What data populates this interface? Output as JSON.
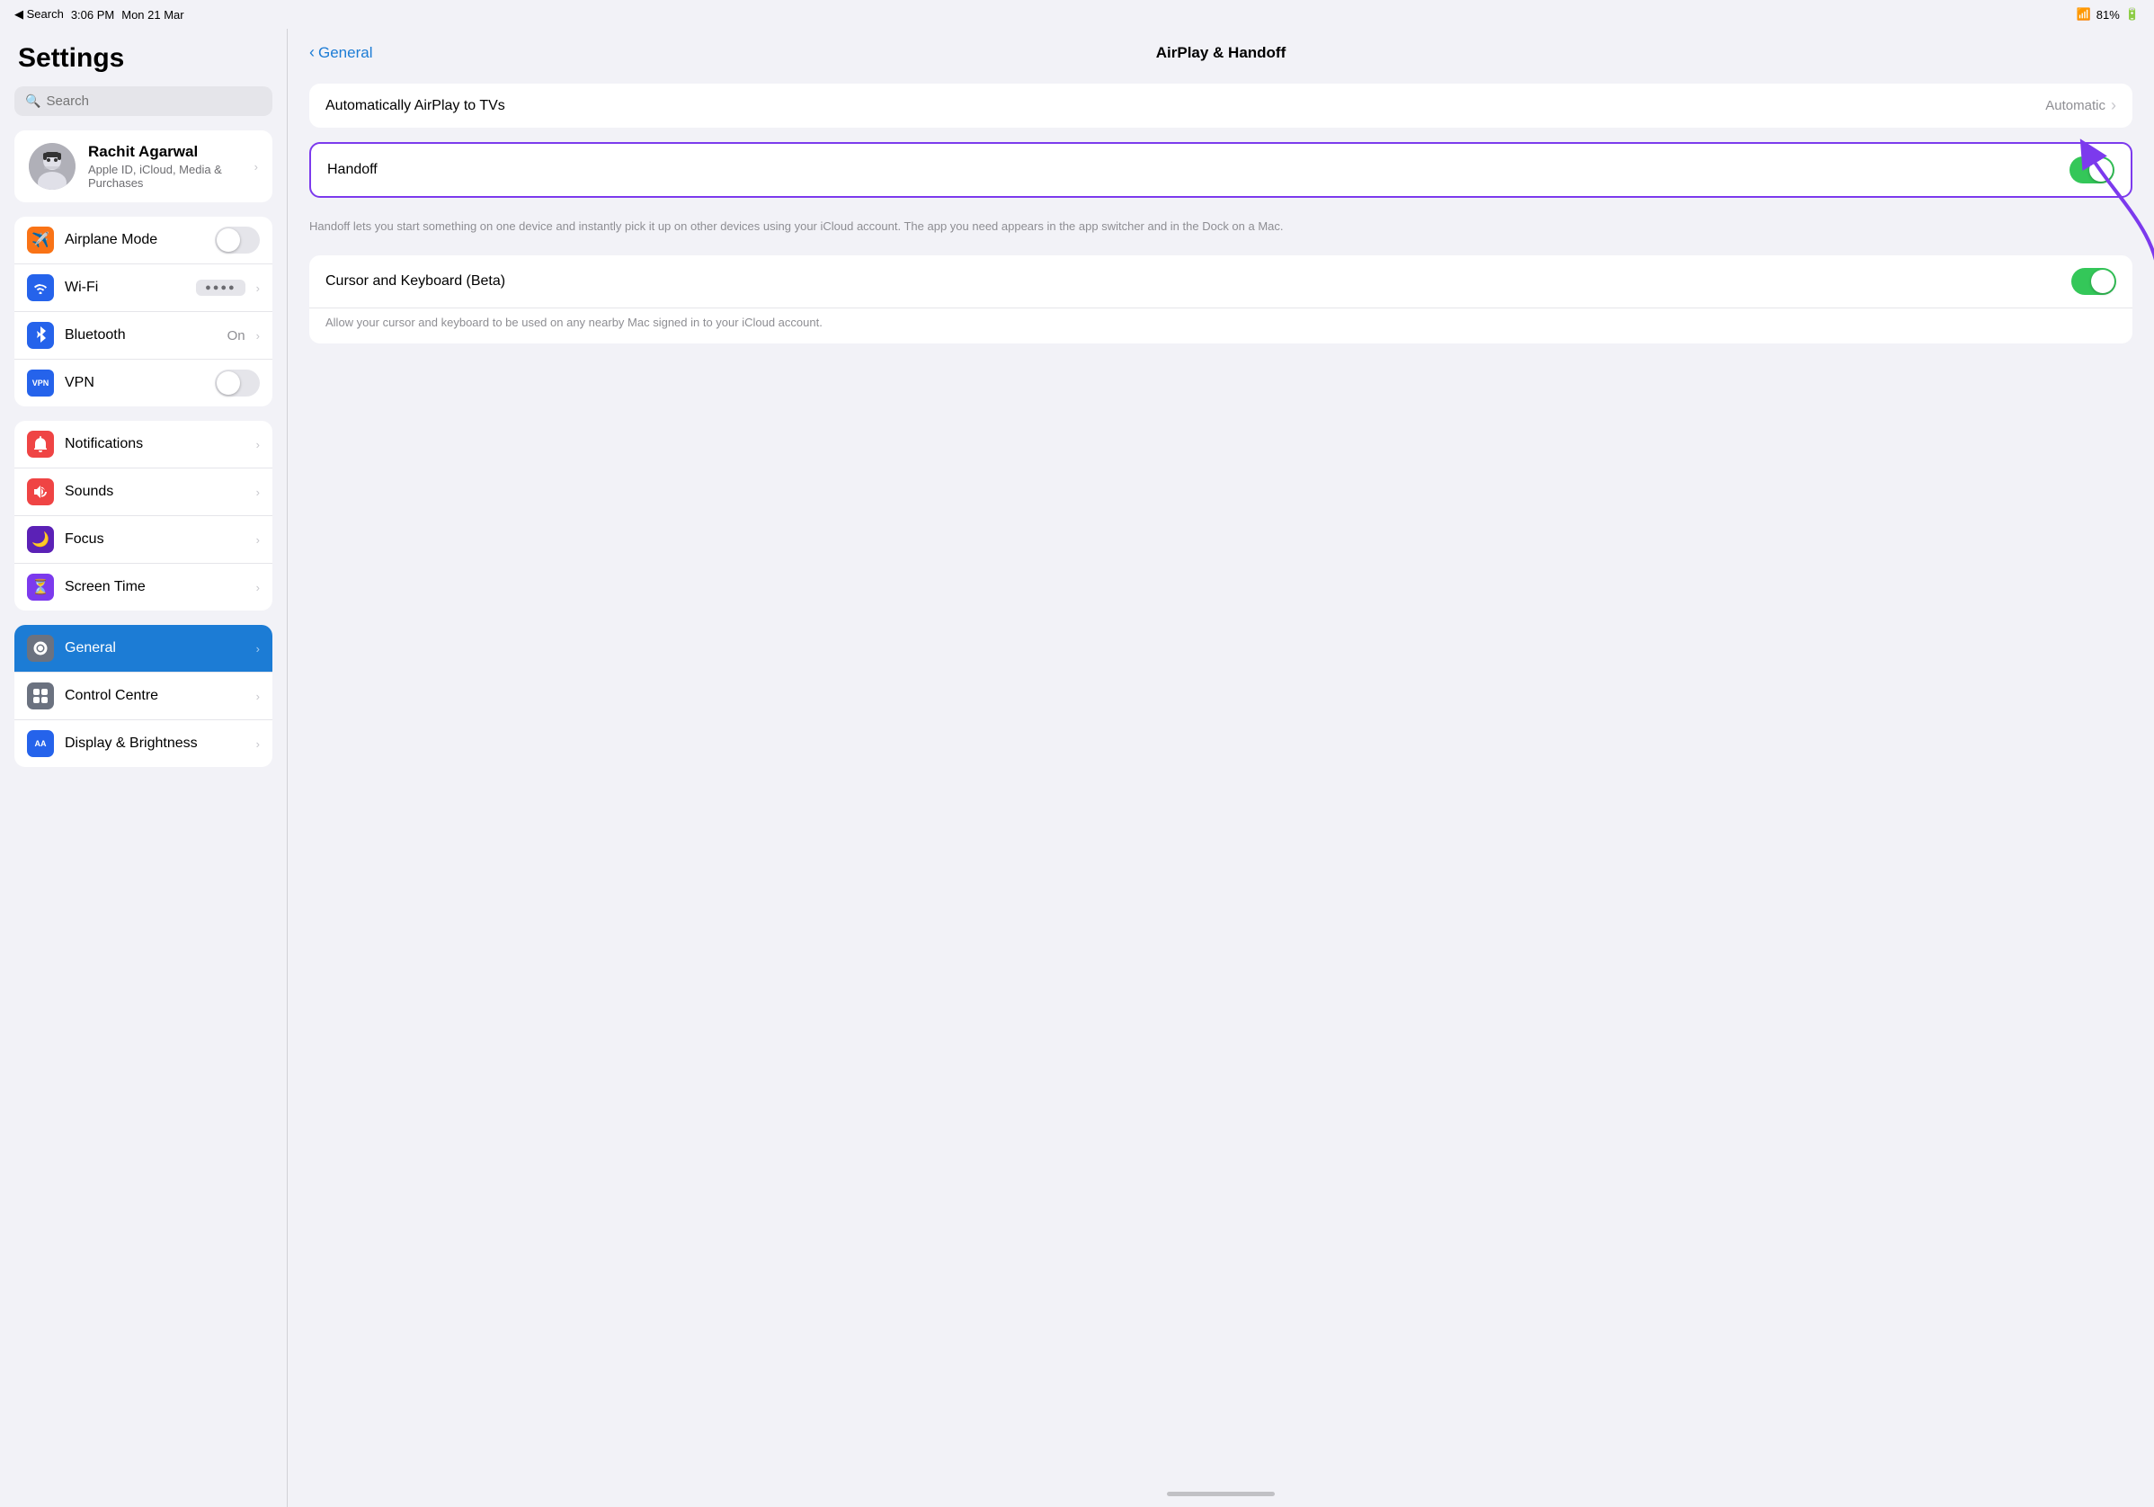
{
  "statusBar": {
    "back": "◀ Search",
    "time": "3:06 PM",
    "date": "Mon 21 Mar",
    "battery": "81%"
  },
  "sidebar": {
    "title": "Settings",
    "search": {
      "placeholder": "Search"
    },
    "profile": {
      "name": "Rachit Agarwal",
      "subtitle": "Apple ID, iCloud, Media & Purchases",
      "avatar_emoji": "🧑‍💻"
    },
    "group1": [
      {
        "id": "airplane",
        "label": "Airplane Mode",
        "control": "toggle-off",
        "icon_bg": "#f97316",
        "icon": "✈️"
      },
      {
        "id": "wifi",
        "label": "Wi-Fi",
        "control": "wifi-value",
        "value": "●●●●●●",
        "icon_bg": "#2563eb",
        "icon": "📶"
      },
      {
        "id": "bluetooth",
        "label": "Bluetooth",
        "control": "value",
        "value": "On",
        "icon_bg": "#2563eb",
        "icon": "✱"
      },
      {
        "id": "vpn",
        "label": "VPN",
        "control": "toggle-off",
        "icon_bg": "#2563eb",
        "icon": "VPN"
      }
    ],
    "group2": [
      {
        "id": "notifications",
        "label": "Notifications",
        "icon_bg": "#ef4444",
        "icon": "🔔"
      },
      {
        "id": "sounds",
        "label": "Sounds",
        "icon_bg": "#ef4444",
        "icon": "🔊"
      },
      {
        "id": "focus",
        "label": "Focus",
        "icon_bg": "#5b21b6",
        "icon": "🌙"
      },
      {
        "id": "screen-time",
        "label": "Screen Time",
        "icon_bg": "#7c3aed",
        "icon": "⏳"
      }
    ],
    "group3": [
      {
        "id": "general",
        "label": "General",
        "icon_bg": "#6b7280",
        "icon": "⚙️",
        "active": true
      },
      {
        "id": "control-centre",
        "label": "Control Centre",
        "icon_bg": "#6b7280",
        "icon": "⊞"
      },
      {
        "id": "display",
        "label": "Display & Brightness",
        "icon_bg": "#2563eb",
        "icon": "AA"
      }
    ]
  },
  "content": {
    "back_label": "General",
    "title": "AirPlay & Handoff",
    "sections": [
      {
        "id": "airplay-section",
        "rows": [
          {
            "id": "airplay-tvs",
            "label": "Automatically AirPlay to TVs",
            "control": "chevron",
            "value": "Automatic"
          }
        ]
      },
      {
        "id": "handoff-section",
        "highlighted": true,
        "rows": [
          {
            "id": "handoff",
            "label": "Handoff",
            "control": "toggle-on"
          }
        ],
        "description": "Handoff lets you start something on one device and instantly pick it up on other devices using your iCloud account. The app you need appears in the app switcher and in the Dock on a Mac."
      },
      {
        "id": "keyboard-section",
        "rows": [
          {
            "id": "cursor-keyboard",
            "label": "Cursor and Keyboard (Beta)",
            "control": "toggle-on"
          }
        ],
        "description": "Allow your cursor and keyboard to be used on any nearby Mac signed in to your iCloud account."
      }
    ]
  }
}
